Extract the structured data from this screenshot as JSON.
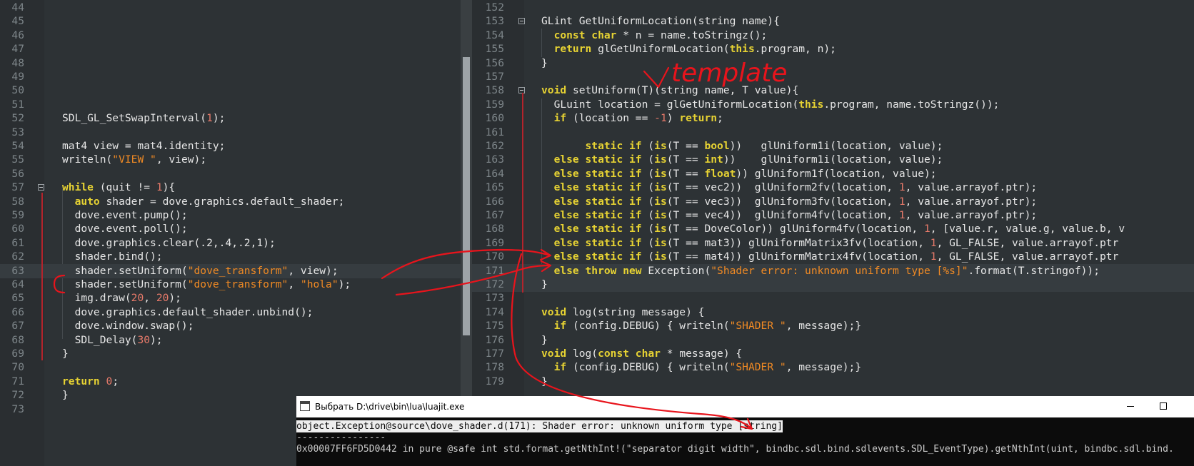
{
  "left_editor": {
    "lines": [
      {
        "n": "44",
        "t": []
      },
      {
        "n": "45",
        "t": []
      },
      {
        "n": "46",
        "t": []
      },
      {
        "n": "47",
        "t": []
      },
      {
        "n": "48",
        "t": []
      },
      {
        "n": "49",
        "t": []
      },
      {
        "n": "50",
        "t": []
      },
      {
        "n": "51",
        "t": []
      },
      {
        "n": "52",
        "t": [
          [
            "id",
            "SDL_GL_SetSwapInterval("
          ],
          [
            "num",
            "1"
          ],
          [
            "id",
            ");"
          ]
        ]
      },
      {
        "n": "53",
        "t": []
      },
      {
        "n": "54",
        "t": [
          [
            "id",
            "mat4 view = mat4.identity;"
          ]
        ]
      },
      {
        "n": "55",
        "t": [
          [
            "id",
            "writeln("
          ],
          [
            "str",
            "\"VIEW \""
          ],
          [
            "id",
            ", view);"
          ]
        ]
      },
      {
        "n": "56",
        "t": []
      },
      {
        "n": "57",
        "t": [
          [
            "kw",
            "while"
          ],
          [
            "id",
            " (quit != "
          ],
          [
            "num",
            "1"
          ],
          [
            "id",
            "){"
          ]
        ],
        "fold": true
      },
      {
        "n": "58",
        "t": [
          [
            "id",
            "  "
          ],
          [
            "kw",
            "auto"
          ],
          [
            "id",
            " shader = dove.graphics.default_shader;"
          ]
        ]
      },
      {
        "n": "59",
        "t": [
          [
            "id",
            "  dove.event.pump();"
          ]
        ]
      },
      {
        "n": "60",
        "t": [
          [
            "id",
            "  dove.event.poll();"
          ]
        ]
      },
      {
        "n": "61",
        "t": [
          [
            "id",
            "  dove.graphics.clear(.2,.4,.2,1);"
          ]
        ]
      },
      {
        "n": "62",
        "t": [
          [
            "id",
            "  shader.bind();"
          ]
        ]
      },
      {
        "n": "63",
        "t": [
          [
            "id",
            "  shader.setUniform("
          ],
          [
            "str",
            "\"dove_transform\""
          ],
          [
            "id",
            ", view);"
          ]
        ],
        "hl": true
      },
      {
        "n": "64",
        "t": [
          [
            "id",
            "  shader.setUniform("
          ],
          [
            "str",
            "\"dove_transform\""
          ],
          [
            "id",
            ", "
          ],
          [
            "str",
            "\"hola\""
          ],
          [
            "id",
            ");"
          ]
        ]
      },
      {
        "n": "65",
        "t": [
          [
            "id",
            "  img.draw("
          ],
          [
            "num",
            "20"
          ],
          [
            "id",
            ", "
          ],
          [
            "num",
            "20"
          ],
          [
            "id",
            ");"
          ]
        ]
      },
      {
        "n": "66",
        "t": [
          [
            "id",
            "  dove.graphics.default_shader.unbind();"
          ]
        ]
      },
      {
        "n": "67",
        "t": [
          [
            "id",
            "  dove.window.swap();"
          ]
        ]
      },
      {
        "n": "68",
        "t": [
          [
            "id",
            "  SDL_Delay("
          ],
          [
            "num",
            "30"
          ],
          [
            "id",
            ");"
          ]
        ]
      },
      {
        "n": "69",
        "t": [
          [
            "id",
            "}"
          ]
        ]
      },
      {
        "n": "70",
        "t": []
      },
      {
        "n": "71",
        "t": [
          [
            "kw",
            "return"
          ],
          [
            "id",
            " "
          ],
          [
            "num",
            "0"
          ],
          [
            "id",
            ";"
          ]
        ]
      },
      {
        "n": "72",
        "t": [
          [
            "id",
            "}"
          ]
        ]
      },
      {
        "n": "73",
        "t": []
      }
    ]
  },
  "right_editor": {
    "lines": [
      {
        "n": "152",
        "t": []
      },
      {
        "n": "153",
        "t": [
          [
            "id",
            "GLint GetUniformLocation(string name){"
          ]
        ],
        "fold": true
      },
      {
        "n": "154",
        "t": [
          [
            "id",
            "  "
          ],
          [
            "kw",
            "const char"
          ],
          [
            "id",
            " * n = name.toStringz();"
          ]
        ]
      },
      {
        "n": "155",
        "t": [
          [
            "id",
            "  "
          ],
          [
            "kw",
            "return"
          ],
          [
            "id",
            " glGetUniformLocation("
          ],
          [
            "kw",
            "this"
          ],
          [
            "id",
            ".program, n);"
          ]
        ]
      },
      {
        "n": "156",
        "t": [
          [
            "id",
            "}"
          ]
        ]
      },
      {
        "n": "157",
        "t": []
      },
      {
        "n": "158",
        "t": [
          [
            "kw",
            "void"
          ],
          [
            "id",
            " setUniform(T)(string name, T value){"
          ]
        ],
        "fold": true
      },
      {
        "n": "159",
        "t": [
          [
            "id",
            "  GLuint location = glGetUniformLocation("
          ],
          [
            "kw",
            "this"
          ],
          [
            "id",
            ".program, name.toStringz());"
          ]
        ]
      },
      {
        "n": "160",
        "t": [
          [
            "id",
            "  "
          ],
          [
            "kw",
            "if"
          ],
          [
            "id",
            " (location == "
          ],
          [
            "num",
            "-1"
          ],
          [
            "id",
            ") "
          ],
          [
            "kw",
            "return"
          ],
          [
            "id",
            ";"
          ]
        ]
      },
      {
        "n": "161",
        "t": []
      },
      {
        "n": "162",
        "t": [
          [
            "id",
            "       "
          ],
          [
            "kw",
            "static if"
          ],
          [
            "id",
            " ("
          ],
          [
            "kw",
            "is"
          ],
          [
            "id",
            "(T == "
          ],
          [
            "kw",
            "bool"
          ],
          [
            "id",
            "))   glUniform1i(location, value);"
          ]
        ]
      },
      {
        "n": "163",
        "t": [
          [
            "id",
            "  "
          ],
          [
            "kw",
            "else static if"
          ],
          [
            "id",
            " ("
          ],
          [
            "kw",
            "is"
          ],
          [
            "id",
            "(T == "
          ],
          [
            "kw",
            "int"
          ],
          [
            "id",
            "))    glUniform1i(location, value);"
          ]
        ]
      },
      {
        "n": "164",
        "t": [
          [
            "id",
            "  "
          ],
          [
            "kw",
            "else static if"
          ],
          [
            "id",
            " ("
          ],
          [
            "kw",
            "is"
          ],
          [
            "id",
            "(T == "
          ],
          [
            "kw",
            "float"
          ],
          [
            "id",
            ")) glUniform1f(location, value);"
          ]
        ]
      },
      {
        "n": "165",
        "t": [
          [
            "id",
            "  "
          ],
          [
            "kw",
            "else static if"
          ],
          [
            "id",
            " ("
          ],
          [
            "kw",
            "is"
          ],
          [
            "id",
            "(T == vec2))  glUniform2fv(location, "
          ],
          [
            "num",
            "1"
          ],
          [
            "id",
            ", value.arrayof.ptr);"
          ]
        ]
      },
      {
        "n": "166",
        "t": [
          [
            "id",
            "  "
          ],
          [
            "kw",
            "else static if"
          ],
          [
            "id",
            " ("
          ],
          [
            "kw",
            "is"
          ],
          [
            "id",
            "(T == vec3))  glUniform3fv(location, "
          ],
          [
            "num",
            "1"
          ],
          [
            "id",
            ", value.arrayof.ptr);"
          ]
        ]
      },
      {
        "n": "167",
        "t": [
          [
            "id",
            "  "
          ],
          [
            "kw",
            "else static if"
          ],
          [
            "id",
            " ("
          ],
          [
            "kw",
            "is"
          ],
          [
            "id",
            "(T == vec4))  glUniform4fv(location, "
          ],
          [
            "num",
            "1"
          ],
          [
            "id",
            ", value.arrayof.ptr);"
          ]
        ]
      },
      {
        "n": "168",
        "t": [
          [
            "id",
            "  "
          ],
          [
            "kw",
            "else static if"
          ],
          [
            "id",
            " ("
          ],
          [
            "kw",
            "is"
          ],
          [
            "id",
            "(T == DoveColor)) glUniform4fv(location, "
          ],
          [
            "num",
            "1"
          ],
          [
            "id",
            ", [value.r, value.g, value.b, v"
          ]
        ]
      },
      {
        "n": "169",
        "t": [
          [
            "id",
            "  "
          ],
          [
            "kw",
            "else static if"
          ],
          [
            "id",
            " ("
          ],
          [
            "kw",
            "is"
          ],
          [
            "id",
            "(T == mat3)) glUniformMatrix3fv(location, "
          ],
          [
            "num",
            "1"
          ],
          [
            "id",
            ", GL_FALSE, value.arrayof.ptr"
          ]
        ]
      },
      {
        "n": "170",
        "t": [
          [
            "id",
            "  "
          ],
          [
            "kw",
            "else static if"
          ],
          [
            "id",
            " ("
          ],
          [
            "kw",
            "is"
          ],
          [
            "id",
            "(T == mat4)) glUniformMatrix4fv(location, "
          ],
          [
            "num",
            "1"
          ],
          [
            "id",
            ", GL_FALSE, value.arrayof.ptr"
          ]
        ]
      },
      {
        "n": "171",
        "t": [
          [
            "id",
            "  "
          ],
          [
            "kw",
            "else throw new"
          ],
          [
            "id",
            " Exception("
          ],
          [
            "str",
            "\"Shader error: unknown uniform type [%s]\""
          ],
          [
            "id",
            ".format(T.stringof));"
          ]
        ],
        "hl": true
      },
      {
        "n": "172",
        "t": [
          [
            "id",
            "}"
          ]
        ],
        "hl": true
      },
      {
        "n": "173",
        "t": []
      },
      {
        "n": "174",
        "t": [
          [
            "kw",
            "void"
          ],
          [
            "id",
            " log(string message) {"
          ]
        ]
      },
      {
        "n": "175",
        "t": [
          [
            "id",
            "  "
          ],
          [
            "kw",
            "if"
          ],
          [
            "id",
            " (config.DEBUG) { writeln("
          ],
          [
            "str",
            "\"SHADER \""
          ],
          [
            "id",
            ", message);}"
          ]
        ]
      },
      {
        "n": "176",
        "t": [
          [
            "id",
            "}"
          ]
        ]
      },
      {
        "n": "177",
        "t": [
          [
            "kw",
            "void"
          ],
          [
            "id",
            " log("
          ],
          [
            "kw",
            "const char"
          ],
          [
            "id",
            " * message) {"
          ]
        ]
      },
      {
        "n": "178",
        "t": [
          [
            "id",
            "  "
          ],
          [
            "kw",
            "if"
          ],
          [
            "id",
            " (config.DEBUG) { writeln("
          ],
          [
            "str",
            "\"SHADER \""
          ],
          [
            "id",
            ", message);}"
          ]
        ]
      },
      {
        "n": "179",
        "t": [
          [
            "id",
            "}"
          ]
        ]
      }
    ]
  },
  "console": {
    "title": "Выбрать D:\\drive\\bin\\lua\\luajit.exe",
    "lines": [
      "object.Exception@source\\dove_shader.d(171): Shader error: unknown uniform type [string]",
      "----------------",
      "0x00007FF6FD5D0442 in pure @safe int std.format.getNthInt!(\"separator digit width\", bindbc.sdl.bind.sdlevents.SDL_EventType).getNthInt(uint, bindbc.sdl.bind."
    ]
  },
  "annotation": {
    "handwritten": "template",
    "color": "#e8141c"
  },
  "icons": {
    "fold": "minus-box-icon",
    "window": "console-window-icon"
  }
}
